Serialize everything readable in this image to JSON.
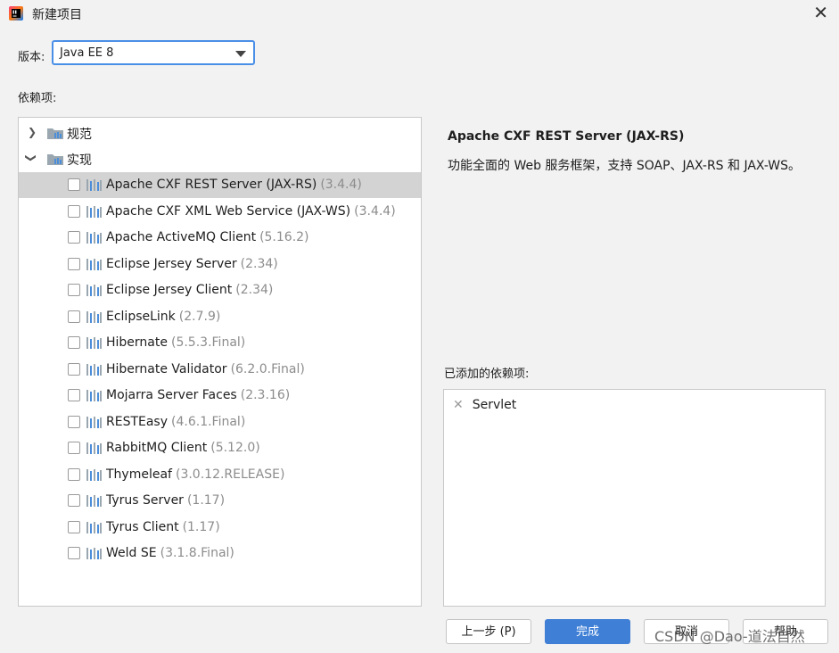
{
  "window": {
    "title": "新建项目"
  },
  "version": {
    "label": "版本:",
    "value": "Java EE 8"
  },
  "dependencies": {
    "label": "依赖项:",
    "groups": [
      {
        "name": "规范",
        "expanded": false
      },
      {
        "name": "实现",
        "expanded": true
      }
    ],
    "items": [
      {
        "name": "Apache CXF REST Server (JAX-RS)",
        "version": "(3.4.4)"
      },
      {
        "name": "Apache CXF XML Web Service (JAX-WS)",
        "version": "(3.4.4)"
      },
      {
        "name": "Apache ActiveMQ Client",
        "version": "(5.16.2)"
      },
      {
        "name": "Eclipse Jersey Server",
        "version": "(2.34)"
      },
      {
        "name": "Eclipse Jersey Client",
        "version": "(2.34)"
      },
      {
        "name": "EclipseLink",
        "version": "(2.7.9)"
      },
      {
        "name": "Hibernate",
        "version": "(5.5.3.Final)"
      },
      {
        "name": "Hibernate Validator",
        "version": "(6.2.0.Final)"
      },
      {
        "name": "Mojarra Server Faces",
        "version": "(2.3.16)"
      },
      {
        "name": "RESTEasy",
        "version": "(4.6.1.Final)"
      },
      {
        "name": "RabbitMQ Client",
        "version": "(5.12.0)"
      },
      {
        "name": "Thymeleaf",
        "version": "(3.0.12.RELEASE)"
      },
      {
        "name": "Tyrus Server",
        "version": "(1.17)"
      },
      {
        "name": "Tyrus Client",
        "version": "(1.17)"
      },
      {
        "name": "Weld SE",
        "version": "(3.1.8.Final)"
      }
    ]
  },
  "detail": {
    "title": "Apache CXF REST Server (JAX-RS)",
    "description": "功能全面的 Web 服务框架，支持 SOAP、JAX-RS 和 JAX-WS。"
  },
  "added": {
    "label": "已添加的依赖项:",
    "items": [
      "Servlet"
    ]
  },
  "buttons": {
    "previous": "上一步 (P)",
    "finish": "完成",
    "cancel": "取消",
    "help": "帮助"
  },
  "watermark": "CSDN @Dao-道法自然",
  "colors": {
    "accent": "#3f7fd6",
    "selection": "#d3d3d3",
    "version_text": "#8c8c8c"
  }
}
